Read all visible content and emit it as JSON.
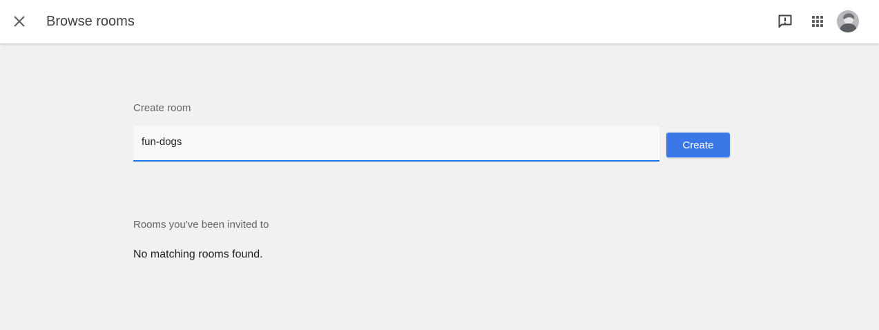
{
  "header": {
    "title": "Browse rooms",
    "close_icon": "close-icon",
    "feedback_icon": "feedback-icon",
    "apps_icon": "apps-grid-icon",
    "avatar_icon": "avatar"
  },
  "create_room": {
    "label": "Create room",
    "input_value": "fun-dogs",
    "button_label": "Create"
  },
  "invited": {
    "label": "Rooms you've been invited to",
    "empty_message": "No matching rooms found."
  },
  "colors": {
    "accent": "#1a73e8",
    "button": "#3b78e7",
    "background": "#f1f1f1"
  }
}
